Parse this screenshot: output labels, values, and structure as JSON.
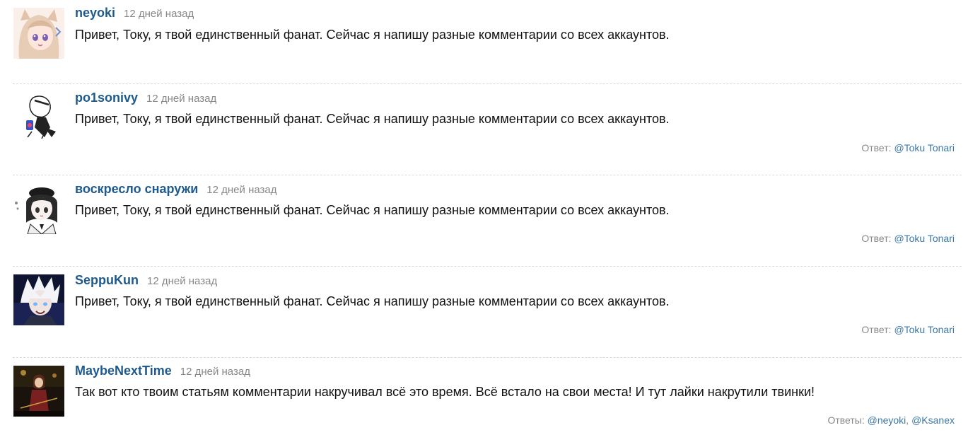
{
  "comments": [
    {
      "author": "neyoki",
      "time": "12 дней назад",
      "text": "Привет, Току, я твой единственный фанат. Сейчас я напишу разные комментарии со всех аккаунтов.",
      "avatar_icon": "anime-catgirl-avatar"
    },
    {
      "author": "po1sonivy",
      "time": "12 дней назад",
      "text": "Привет, Току, я твой единственный фанат. Сейчас я напишу разные комментарии со всех аккаунтов.",
      "avatar_icon": "anime-sketch-avatar",
      "replies_label": "Ответ:",
      "replies": [
        "@Toku Tonari"
      ]
    },
    {
      "author": "воскресло снаружи",
      "time": "12 дней назад",
      "text": "Привет, Току, я твой единственный фанат. Сейчас я напишу разные комментарии со всех аккаунтов.",
      "avatar_icon": "anime-girl-beret-avatar",
      "replies_label": "Ответ:",
      "replies": [
        "@Toku Tonari"
      ]
    },
    {
      "author": "SeppuKun",
      "time": "12 дней назад",
      "text": "Привет, Току, я твой единственный фанат. Сейчас я напишу разные комментарии со всех аккаунтов.",
      "avatar_icon": "anime-white-hair-avatar",
      "replies_label": "Ответ:",
      "replies": [
        "@Toku Tonari"
      ]
    },
    {
      "author": "MaybeNextTime",
      "time": "12 дней назад",
      "text": "Так вот кто твоим статьям комментарии накручивал всё это время. Всё встало на свои места! И тут лайки накрутили твинки!",
      "avatar_icon": "dark-scene-avatar",
      "replies_label": "Ответы:",
      "replies": [
        "@neyoki",
        "@Ksanex"
      ]
    }
  ],
  "colors": {
    "author": "#1f5a8c",
    "link": "#3a78a8",
    "muted": "#888888",
    "divider": "#d9d9d9"
  }
}
